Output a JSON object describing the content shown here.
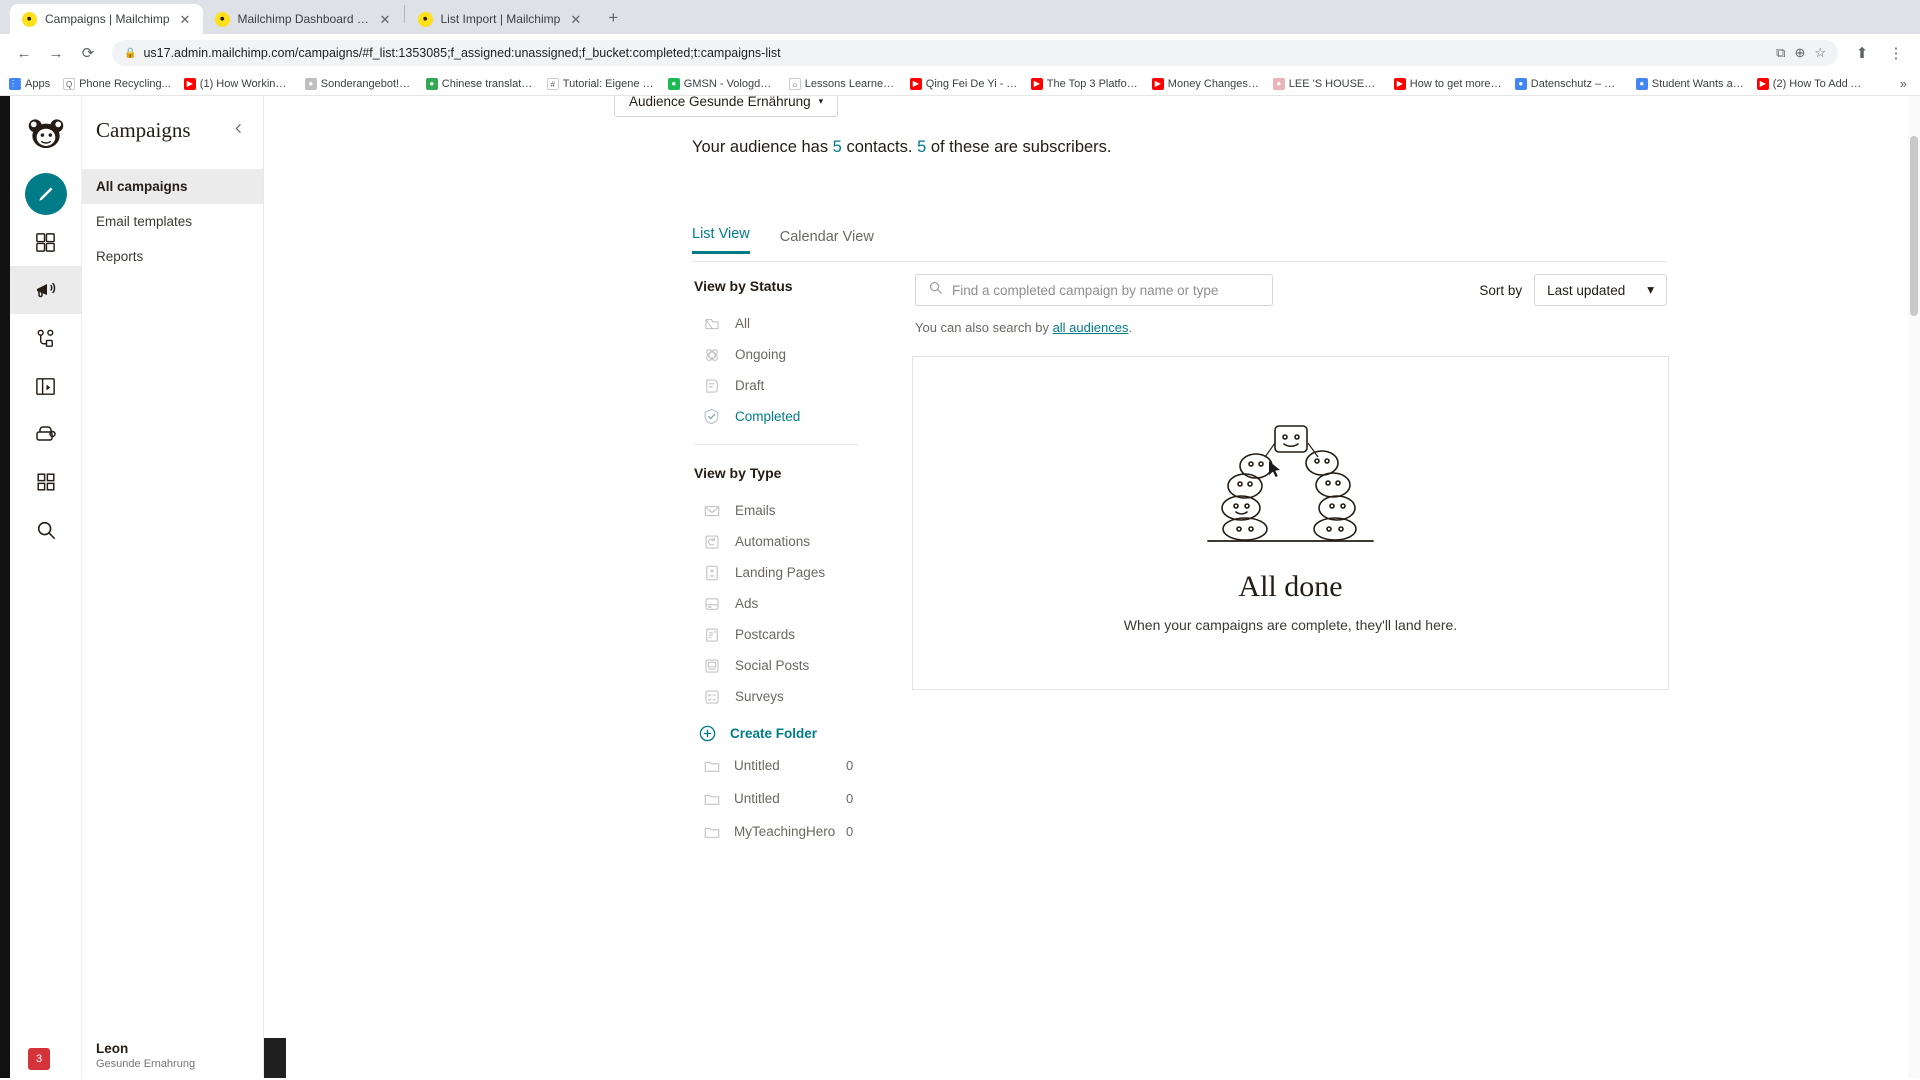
{
  "browser": {
    "tabs": [
      {
        "title": "Campaigns | Mailchimp",
        "active": true
      },
      {
        "title": "Mailchimp Dashboard | Mailch",
        "active": false
      },
      {
        "title": "List Import | Mailchimp",
        "active": false
      }
    ],
    "new_tab_label": "+",
    "nav": {
      "back": "←",
      "forward": "→",
      "reload": "⟳",
      "lock": "🔒",
      "url": "us17.admin.mailchimp.com/campaigns/#f_list:1353085;f_assigned:unassigned;f_bucket:completed;t:campaigns-list",
      "ext_icon": "⧉",
      "zoom_icon": "⊕",
      "star_icon": "☆",
      "share_icon": "⬆",
      "menu_icon": "⋮"
    },
    "bookmarks": [
      {
        "label": "Apps",
        "color": "#4285f4",
        "glyph": "⋮⋮"
      },
      {
        "label": "Phone Recycling...",
        "color": "#ffffff",
        "glyph": "Q"
      },
      {
        "label": "(1) How Working a...",
        "color": "#ff0000",
        "glyph": "▶"
      },
      {
        "label": "Sonderangebot! |...",
        "color": "#bfbfbf",
        "glyph": "●"
      },
      {
        "label": "Chinese translatio...",
        "color": "#34a853",
        "glyph": "●"
      },
      {
        "label": "Tutorial: Eigene Fa...",
        "color": "#ffffff",
        "glyph": "#"
      },
      {
        "label": "GMSN - Vologda,...",
        "color": "#1db954",
        "glyph": "●"
      },
      {
        "label": "Lessons Learned f...",
        "color": "#ffffff",
        "glyph": "☼"
      },
      {
        "label": "Qing Fei De Yi - Y...",
        "color": "#ff0000",
        "glyph": "▶"
      },
      {
        "label": "The Top 3 Platfor...",
        "color": "#ff0000",
        "glyph": "▶"
      },
      {
        "label": "Money Changes E...",
        "color": "#ff0000",
        "glyph": "▶"
      },
      {
        "label": "LEE 'S HOUSE—...",
        "color": "#e8b4b8",
        "glyph": "●"
      },
      {
        "label": "How to get more v...",
        "color": "#ff0000",
        "glyph": "▶"
      },
      {
        "label": "Datenschutz – Re...",
        "color": "#4285f4",
        "glyph": "●"
      },
      {
        "label": "Student Wants an...",
        "color": "#4285f4",
        "glyph": "●"
      },
      {
        "label": "(2) How To Add A...",
        "color": "#ff0000",
        "glyph": "▶"
      }
    ],
    "bookmarks_overflow": "»"
  },
  "rail": {
    "logo_name": "mailchimp-logo",
    "items": [
      {
        "name": "create-button",
        "icon": "pencil-icon",
        "active": false
      },
      {
        "name": "audience-nav",
        "icon": "audience-icon",
        "active": false
      },
      {
        "name": "campaigns-nav",
        "icon": "megaphone-icon",
        "active": true
      },
      {
        "name": "automations-nav",
        "icon": "automations-icon",
        "active": false
      },
      {
        "name": "website-nav",
        "icon": "website-icon",
        "active": false
      },
      {
        "name": "content-studio-nav",
        "icon": "content-studio-icon",
        "active": false
      },
      {
        "name": "integrations-nav",
        "icon": "grid-icon",
        "active": false
      },
      {
        "name": "search-nav",
        "icon": "search-icon",
        "active": false
      }
    ],
    "badge_count": "3"
  },
  "navpanel": {
    "title": "Campaigns",
    "collapse_icon": "chevron-left-icon",
    "items": [
      {
        "label": "All campaigns",
        "active": true
      },
      {
        "label": "Email templates",
        "active": false
      },
      {
        "label": "Reports",
        "active": false
      }
    ],
    "user_name": "Leon",
    "user_sub": "Gesunde Ernahrung"
  },
  "main": {
    "audience_select": {
      "label": "Audience Gesunde Ernährung",
      "caret": "▾"
    },
    "audience_line": {
      "prefix": "Your audience has ",
      "contacts": "5",
      "middle": " contacts. ",
      "subscribers": "5",
      "suffix": " of these are subscribers."
    },
    "view_tabs": [
      {
        "label": "List View",
        "active": true
      },
      {
        "label": "Calendar View",
        "active": false
      }
    ],
    "status_filter": {
      "heading": "View by Status",
      "items": [
        {
          "label": "All",
          "icon": "all-campaigns-icon",
          "active": false
        },
        {
          "label": "Ongoing",
          "icon": "ongoing-icon",
          "active": false
        },
        {
          "label": "Draft",
          "icon": "draft-icon",
          "active": false
        },
        {
          "label": "Completed",
          "icon": "completed-check-icon",
          "active": true
        }
      ]
    },
    "type_filter": {
      "heading": "View by Type",
      "items": [
        {
          "label": "Emails",
          "icon": "envelope-icon"
        },
        {
          "label": "Automations",
          "icon": "automation-icon"
        },
        {
          "label": "Landing Pages",
          "icon": "landing-page-icon"
        },
        {
          "label": "Ads",
          "icon": "ads-icon"
        },
        {
          "label": "Postcards",
          "icon": "postcard-icon"
        },
        {
          "label": "Social Posts",
          "icon": "social-post-icon"
        },
        {
          "label": "Surveys",
          "icon": "survey-icon"
        }
      ]
    },
    "folders": {
      "create_label": "Create Folder",
      "create_icon": "plus-circle-icon",
      "items": [
        {
          "name": "Untitled",
          "count": "0"
        },
        {
          "name": "Untitled",
          "count": "0"
        },
        {
          "name": "MyTeachingHero",
          "count": "0"
        }
      ]
    },
    "search": {
      "icon": "search-icon",
      "placeholder": "Find a completed campaign by name or type",
      "value": ""
    },
    "sort": {
      "label": "Sort by",
      "selected": "Last updated",
      "caret": "▾"
    },
    "also_search": {
      "prefix": "You can also search by ",
      "link": "all audiences",
      "suffix": "."
    },
    "empty_state": {
      "illustration": "people-arch-illustration",
      "title": "All done",
      "subtitle": "When your campaigns are complete, they'll land here."
    }
  },
  "colors": {
    "brand_yellow": "#ffe01b",
    "teal": "#007c89",
    "text_dark": "#241c15",
    "text_muted": "#6c6763"
  }
}
